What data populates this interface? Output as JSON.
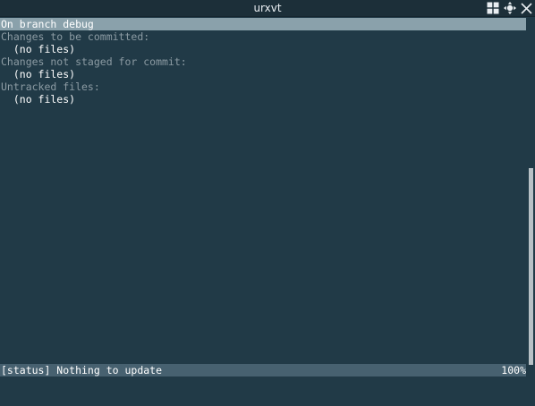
{
  "window": {
    "title": "urxvt"
  },
  "colors": {
    "background": "#213a47",
    "titlebar": "#1c2f39",
    "highlight_line": "#8aa1ab",
    "section_header": "#8c9ba3",
    "statusbar": "#476170"
  },
  "icons": {
    "layout": "grid-icon",
    "move": "move-icon",
    "close": "close-icon"
  },
  "status_view": {
    "branch_line": "On branch debug",
    "sections": [
      {
        "header": "Changes to be committed:",
        "entries": [
          "  (no files)"
        ]
      },
      {
        "header": "Changes not staged for commit:",
        "entries": [
          "  (no files)"
        ]
      },
      {
        "header": "Untracked files:",
        "entries": [
          "  (no files)"
        ]
      }
    ]
  },
  "statusbar": {
    "message": "[status] Nothing to update",
    "position": "100%"
  }
}
